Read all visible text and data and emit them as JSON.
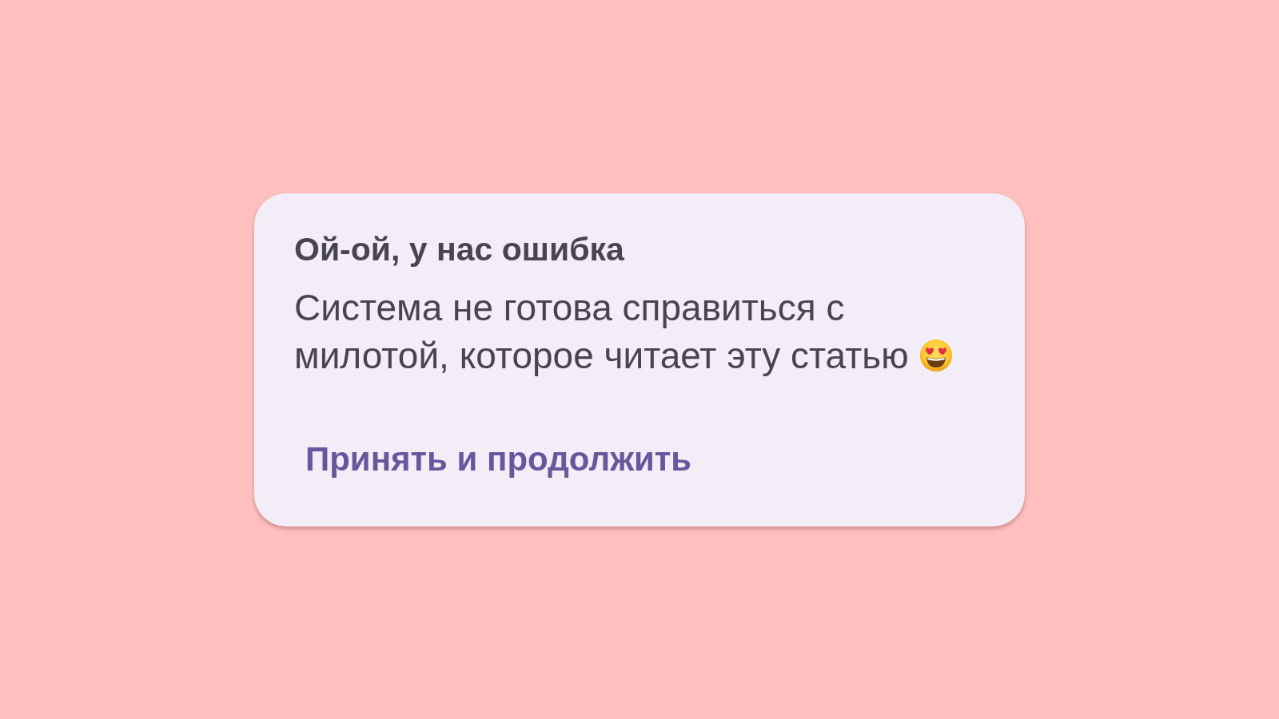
{
  "dialog": {
    "title": "Ой-ой, у нас ошибка",
    "message": "Система не готова справиться с милотой, которое читает эту статью",
    "actions": [
      "Принять и продолжить"
    ]
  }
}
